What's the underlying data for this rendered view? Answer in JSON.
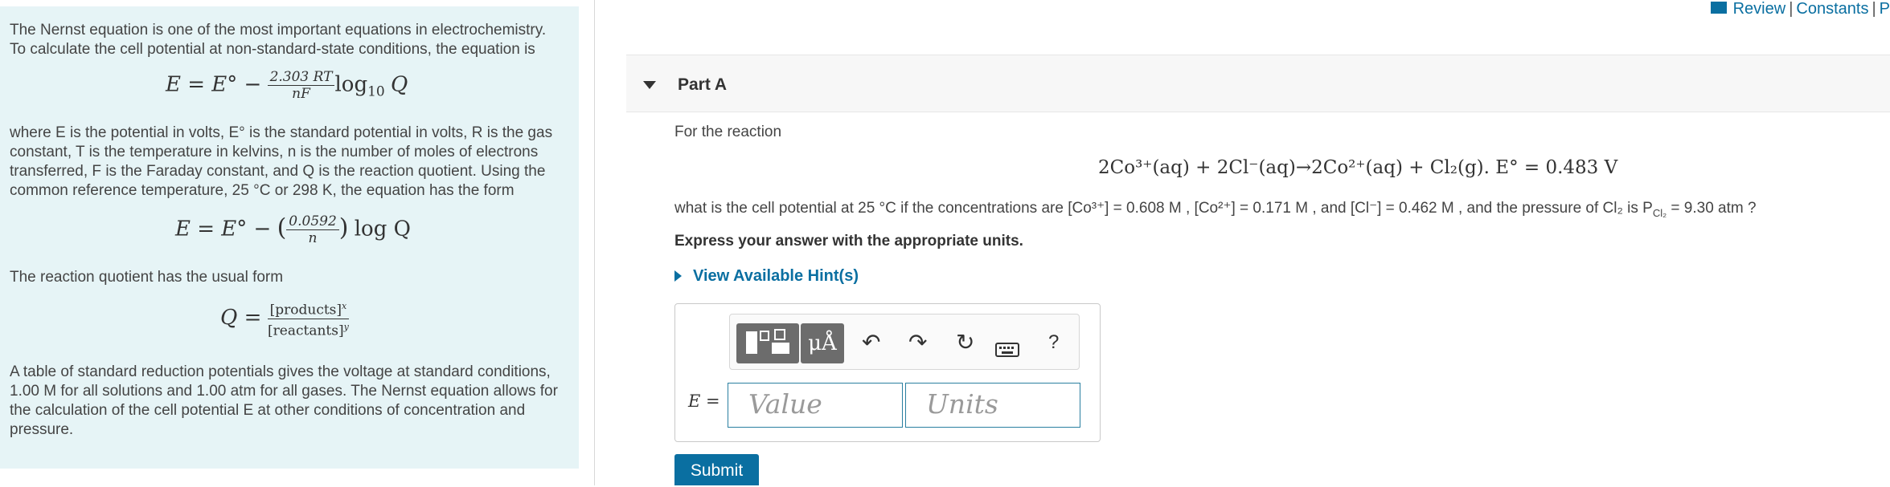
{
  "header_links": {
    "review": "Review",
    "constants": "Constants",
    "periodic": "P",
    "sep": "|"
  },
  "intro": {
    "p1": "The Nernst equation is one of the most important equations in electrochemistry. To calculate the cell potential at non-standard-state conditions, the equation is",
    "eq1": {
      "lhs": "E = E° −",
      "num": "2.303 RT",
      "den": "nF",
      "rhs": "log",
      "sub": "10",
      "q": "Q"
    },
    "p2": "where E is the potential in volts, E° is the standard potential in volts, R is the gas constant, T is the temperature in kelvins, n is the number of moles of electrons transferred, F is the Faraday constant, and Q is the reaction quotient. Using the common reference temperature, 25 °C or 298 K, the equation has the form",
    "eq2": {
      "lhs": "E = E° −",
      "num": "0.0592",
      "den": "n",
      "rhs": "log Q"
    },
    "p3": "The reaction quotient has the usual form",
    "eq3": {
      "lhs": "Q =",
      "num": "[products]",
      "num_exp": "x",
      "den": "[reactants]",
      "den_exp": "y"
    },
    "p4": "A table of standard reduction potentials gives the voltage at standard conditions, 1.00 M for all solutions and 1.00 atm for all gases. The Nernst equation allows for the calculation of the cell potential E at other conditions of concentration and pressure."
  },
  "part": {
    "title": "Part A"
  },
  "question": {
    "lead": "For the reaction",
    "reaction": "2Co³⁺(aq) + 2Cl⁻(aq)→2Co²⁺(aq) + Cl₂(g).  E° = 0.483 V",
    "prompt": "what is the cell potential at 25 °C if the concentrations are [Co³⁺] = 0.608 M , [Co²⁺] = 0.171 M , and [Cl⁻] = 0.462 M , and the pressure of Cl₂ is P",
    "prompt_sub": "Cl₂",
    "prompt_tail": " = 9.30 atm ?",
    "instruction": "Express your answer with the appropriate units.",
    "hint_link": "View Available Hint(s)"
  },
  "answer": {
    "label": "E =",
    "value_placeholder": "Value",
    "units_placeholder": "Units",
    "units_button": "μÅ",
    "help": "?"
  },
  "submit_label": "Submit",
  "colors": {
    "panel_bg": "#e6f4f6",
    "link": "#0a6fa1",
    "button": "#0a6fa1",
    "toolbar_btn": "#6c6c6c"
  }
}
